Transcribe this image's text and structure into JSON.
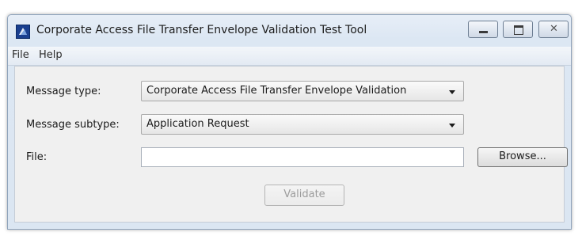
{
  "window": {
    "title": "Corporate Access File Transfer Envelope Validation Test Tool",
    "controls": {
      "minimize": "minimize-icon",
      "maximize": "maximize-icon",
      "close": "close-icon"
    }
  },
  "menu": {
    "items": [
      {
        "label": "File"
      },
      {
        "label": "Help"
      }
    ]
  },
  "form": {
    "message_type": {
      "label": "Message type:",
      "value": "Corporate Access File Transfer Envelope Validation"
    },
    "message_subtype": {
      "label": "Message subtype:",
      "value": "Application Request"
    },
    "file": {
      "label": "File:",
      "value": ""
    },
    "browse_label": "Browse...",
    "validate_label": "Validate",
    "validate_enabled": false
  },
  "colors": {
    "title_bar": "#dce7f3",
    "content_bg": "#f0f0f0",
    "app_icon": "#1a3f8f",
    "disabled_text": "#9c9c9c"
  }
}
